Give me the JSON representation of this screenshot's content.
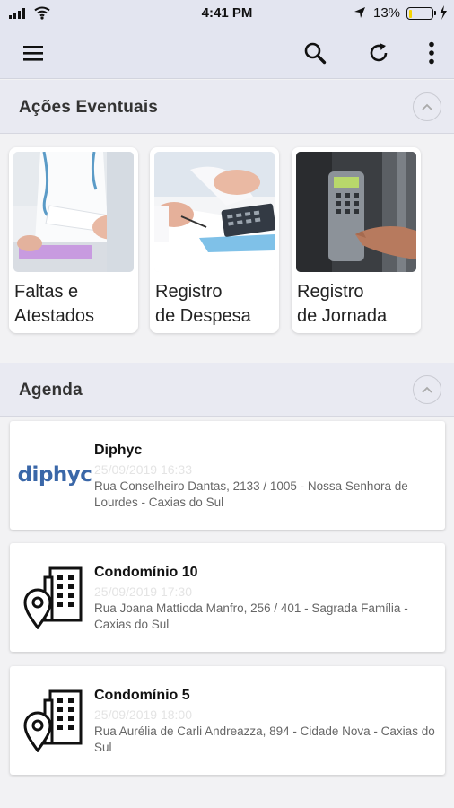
{
  "status_bar": {
    "time": "4:41 PM",
    "battery_percent": "13%",
    "battery_level": 0.13,
    "icons": [
      "signal-icon",
      "wifi-icon",
      "location-arrow-icon",
      "battery-icon",
      "charging-bolt-icon"
    ]
  },
  "app_bar": {
    "icons": [
      "menu-icon",
      "search-icon",
      "refresh-icon",
      "more-vertical-icon"
    ]
  },
  "sections": {
    "acoes": {
      "title": "Ações Eventuais",
      "toggle_icon": "chevron-up-icon"
    },
    "agenda": {
      "title": "Agenda",
      "toggle_icon": "chevron-up-icon"
    }
  },
  "actions": [
    {
      "label": "Faltas e\nAtestados",
      "image": "doctor-photo"
    },
    {
      "label": "Registro\nde Despesa",
      "image": "calculator-photo"
    },
    {
      "label": "Registro\nde Jornada",
      "image": "time-clock-photo"
    }
  ],
  "agenda": [
    {
      "name": "Diphyc",
      "datetime": "25/09/2019 16:33",
      "address": "Rua Conselheiro Dantas, 2133 / 1005 - Nossa Senhora de Lourdes - Caxias do Sul",
      "logo_text": "diphyc"
    },
    {
      "name": "Condomínio 10",
      "datetime": "25/09/2019 17:30",
      "address": "Rua Joana Mattioda Manfro, 256 / 401 - Sagrada Família - Caxias do Sul",
      "icon": "building-location-icon"
    },
    {
      "name": "Condomínio 5",
      "datetime": "25/09/2019 18:00",
      "address": "Rua Aurélia de Carli Andreazza, 894 - Cidade Nova - Caxias do Sul",
      "icon": "building-location-icon"
    }
  ],
  "colors": {
    "header_bg": "#e3e5f0",
    "section_bg": "#e9eaf2",
    "page_bg": "#f2f2f4",
    "logo_blue": "#3a67a8",
    "battery_yellow": "#f5d400"
  }
}
